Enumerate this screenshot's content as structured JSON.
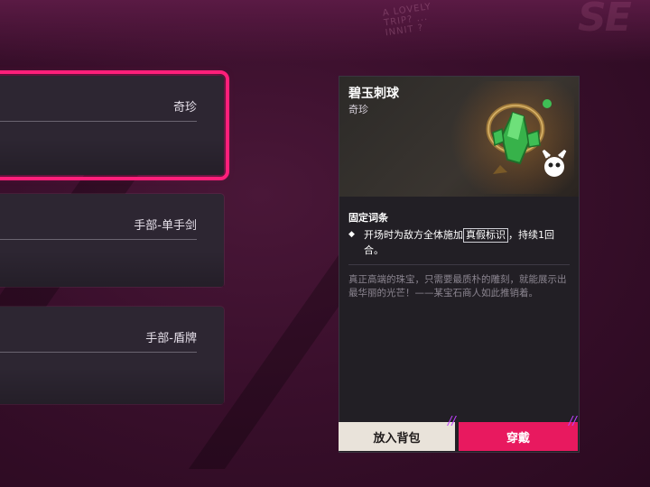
{
  "background": {
    "deco_text": "A LOVELY TRIP? ... INNIT ?",
    "deco_logo": "SE"
  },
  "colors": {
    "accent": "#ff1f7a",
    "equip_button": "#e8195f",
    "panel": "#221f25",
    "card": "#2d2632"
  },
  "item_list": [
    {
      "category": "奇珍",
      "selected": true
    },
    {
      "category": "手部-单手剑",
      "selected": false
    },
    {
      "category": "手部-盾牌",
      "selected": false
    }
  ],
  "detail": {
    "name": "碧玉刺球",
    "rarity": "奇珍",
    "art_icon": "jade-spike-ball-icon",
    "section_title": "固定词条",
    "effect_before": "开场时为敌方全体施加",
    "effect_keyword": "真假标识",
    "effect_after": "，持续1回合。",
    "flavor": "真正高端的珠宝，只需要最质朴的雕刻，就能展示出最华丽的光芒！——某宝石商人如此推销着。"
  },
  "buttons": {
    "bag_label": "放入背包",
    "equip_label": "穿戴"
  }
}
